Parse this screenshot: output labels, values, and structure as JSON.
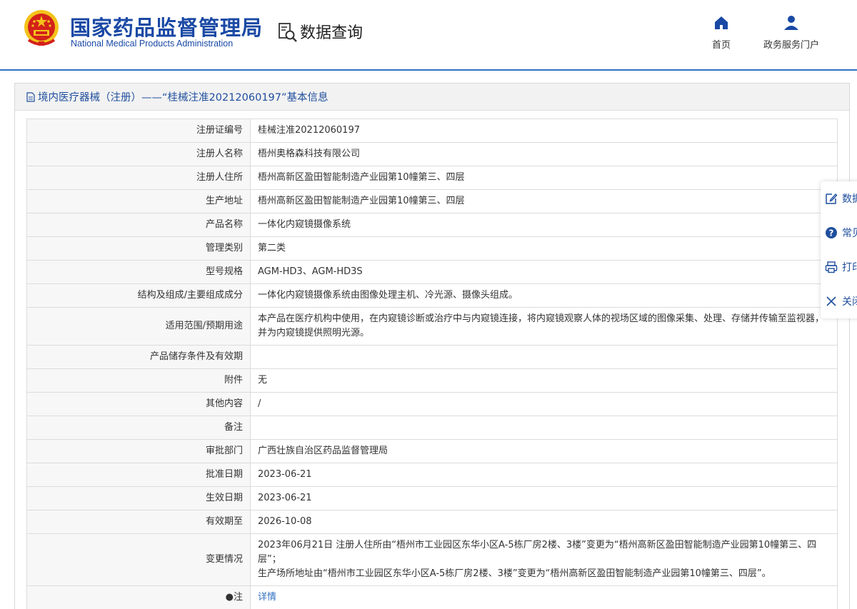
{
  "header": {
    "title_cn": "国家药品监督管理局",
    "title_en": "National Medical Products Administration",
    "section": "数据查询",
    "nav": [
      {
        "label": "首页",
        "icon": "home-icon"
      },
      {
        "label": "政务服务门户",
        "icon": "user-icon"
      }
    ]
  },
  "panel": {
    "title": "境内医疗器械（注册）——“桂械注准20212060197”基本信息"
  },
  "rows": [
    {
      "label": "注册证编号",
      "value": "桂械注准20212060197"
    },
    {
      "label": "注册人名称",
      "value": "梧州奥格森科技有限公司"
    },
    {
      "label": "注册人住所",
      "value": "梧州高新区盈田智能制造产业园第10幢第三、四层"
    },
    {
      "label": "生产地址",
      "value": "梧州高新区盈田智能制造产业园第10幢第三、四层"
    },
    {
      "label": "产品名称",
      "value": "一体化内窥镜摄像系统"
    },
    {
      "label": "管理类别",
      "value": "第二类"
    },
    {
      "label": "型号规格",
      "value": "AGM-HD3、AGM-HD3S"
    },
    {
      "label": "结构及组成/主要组成成分",
      "value": "一体化内窥镜摄像系统由图像处理主机、冷光源、摄像头组成。"
    },
    {
      "label": "适用范围/预期用途",
      "value": "本产品在医疗机构中使用，在内窥镜诊断或治疗中与内窥镜连接，将内窥镜观察人体的视场区域的图像采集、处理、存储并传输至监视器，并为内窥镜提供照明光源。"
    },
    {
      "label": "产品储存条件及有效期",
      "value": ""
    },
    {
      "label": "附件",
      "value": "无"
    },
    {
      "label": "其他内容",
      "value": "/"
    },
    {
      "label": "备注",
      "value": ""
    },
    {
      "label": "审批部门",
      "value": "广西壮族自治区药品监督管理局"
    },
    {
      "label": "批准日期",
      "value": "2023-06-21"
    },
    {
      "label": "生效日期",
      "value": "2023-06-21"
    },
    {
      "label": "有效期至",
      "value": "2026-10-08"
    },
    {
      "label": "变更情况",
      "value_lines": [
        "2023年06月21日 注册人住所由“梧州市工业园区东华小区A-5栋厂房2楼、3楼”变更为“梧州高新区盈田智能制造产业园第10幢第三、四层”；",
        "生产场所地址由“梧州市工业园区东华小区A-5栋厂房2楼、3楼”变更为“梧州高新区盈田智能制造产业园第10幢第三、四层”。"
      ]
    },
    {
      "label": "●注",
      "value": "详情"
    }
  ],
  "side_toolbar": [
    {
      "label": "数据",
      "icon": "edit-icon"
    },
    {
      "label": "常见",
      "icon": "question-icon"
    },
    {
      "label": "打印",
      "icon": "print-icon"
    },
    {
      "label": "关闭",
      "icon": "close-icon"
    }
  ],
  "colors": {
    "brand_blue": "#1a49a5",
    "link_blue": "#2f6fc1",
    "header_rule": "#2f6fc1",
    "emblem_red": "#d3221a",
    "emblem_gold": "#f3c21b"
  }
}
